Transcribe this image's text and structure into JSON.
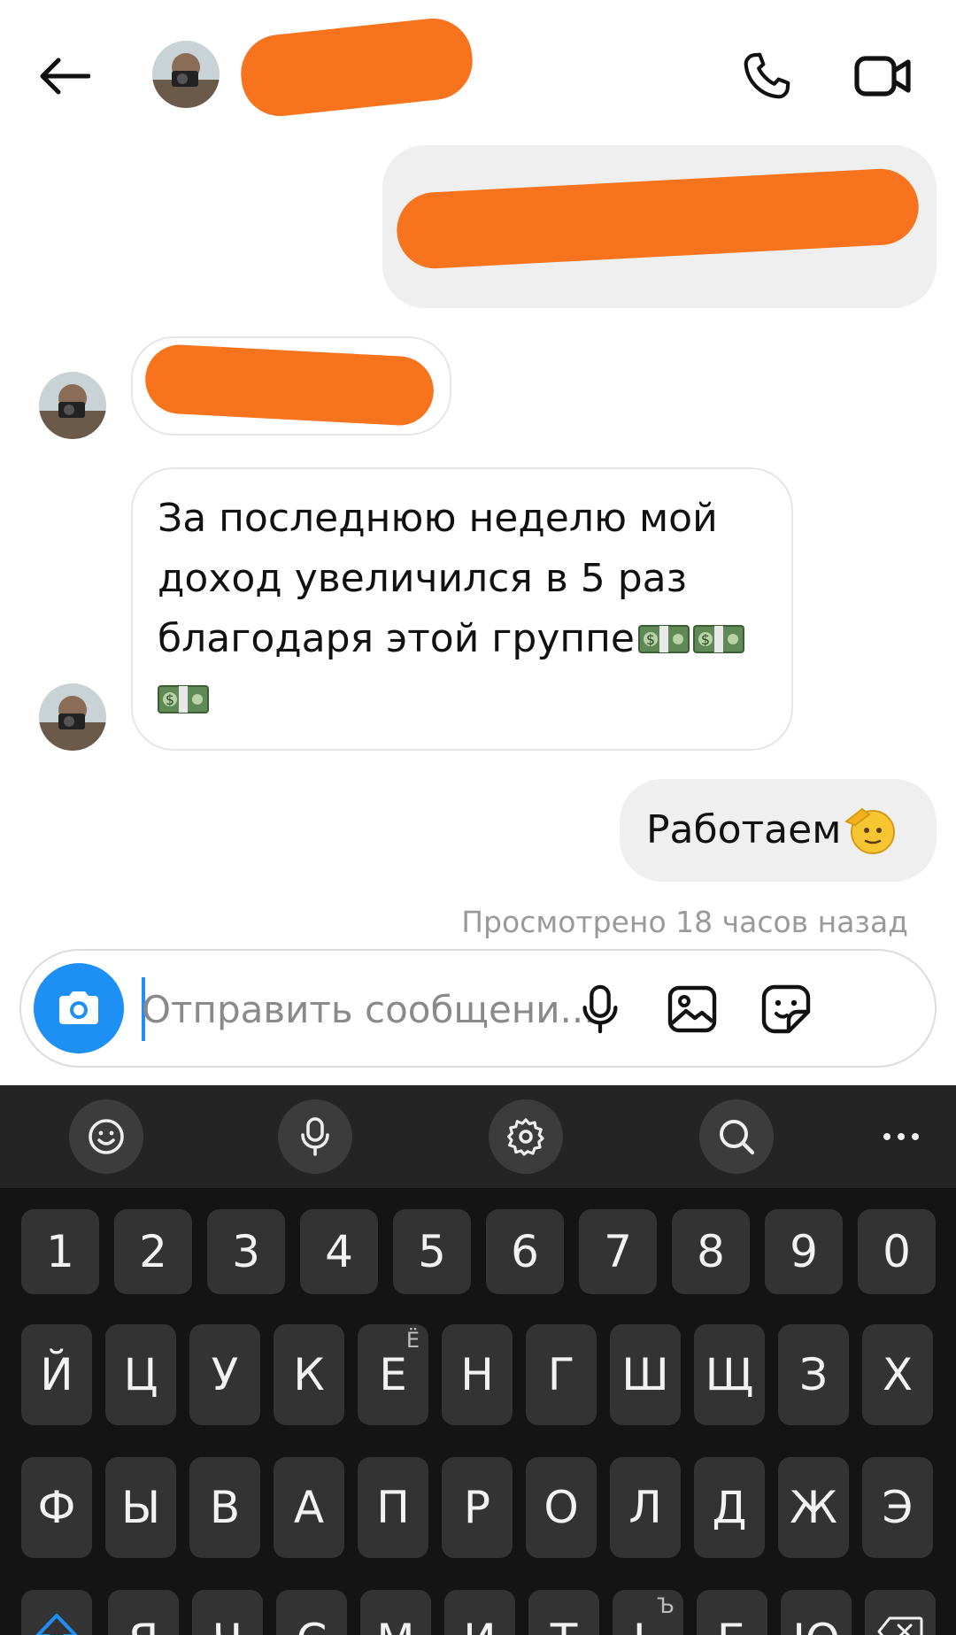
{
  "header": {
    "back_icon": "arrow-left-icon",
    "call_icon": "phone-icon",
    "video_icon": "video-camera-icon"
  },
  "messages": {
    "incoming_long": {
      "lines": [
        "За последнюю неделю мой",
        "доход увеличился в 5 раз",
        "благодаря этой группе"
      ],
      "emoji": "money-banknote-emoji"
    },
    "outgoing_last": {
      "text": "Работаем",
      "emoji": "saluting-face-emoji"
    },
    "seen_status": "Просмотрено 18 часов назад"
  },
  "composer": {
    "placeholder": "Отправить сообщени...",
    "camera_icon": "camera-icon",
    "mic_icon": "microphone-icon",
    "gallery_icon": "image-icon",
    "sticker_icon": "sticker-icon"
  },
  "keyboard": {
    "toolbar": [
      "emoji-icon",
      "microphone-icon",
      "settings-icon",
      "search-icon",
      "more-icon"
    ],
    "number_row": [
      "1",
      "2",
      "3",
      "4",
      "5",
      "6",
      "7",
      "8",
      "9",
      "0"
    ],
    "row1": [
      {
        "k": "Й"
      },
      {
        "k": "Ц"
      },
      {
        "k": "У"
      },
      {
        "k": "К"
      },
      {
        "k": "Е",
        "alt": "Ё"
      },
      {
        "k": "Н"
      },
      {
        "k": "Г"
      },
      {
        "k": "Ш"
      },
      {
        "k": "Щ"
      },
      {
        "k": "З"
      },
      {
        "k": "Х"
      }
    ],
    "row2": [
      "Ф",
      "Ы",
      "В",
      "А",
      "П",
      "Р",
      "О",
      "Л",
      "Д",
      "Ж",
      "Э"
    ],
    "row3": [
      {
        "k": "Я"
      },
      {
        "k": "Ч"
      },
      {
        "k": "С"
      },
      {
        "k": "М"
      },
      {
        "k": "И"
      },
      {
        "k": "Т"
      },
      {
        "k": "Ь",
        "alt": "Ъ"
      },
      {
        "k": "Б"
      },
      {
        "k": "Ю"
      }
    ]
  },
  "colors": {
    "accent": "#1e8ff5",
    "redaction": "#f8731d",
    "outgoing_bubble": "#efefef",
    "keyboard_bg": "#141414",
    "key_bg": "#333333"
  }
}
